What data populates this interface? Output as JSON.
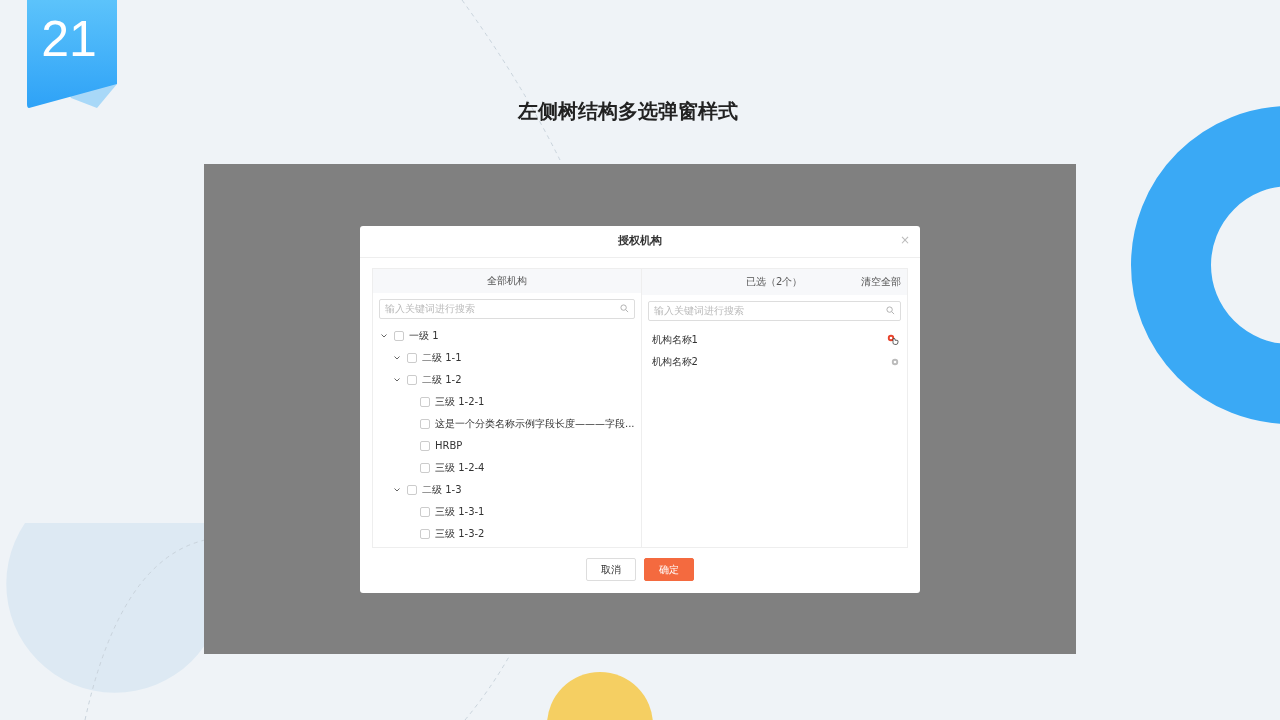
{
  "page_number": "21",
  "title": "左侧树结构多选弹窗样式",
  "dialog": {
    "title": "授权机构",
    "close": "×",
    "left_panel": {
      "header": "全部机构",
      "search": {
        "placeholder": "输入关键词进行搜索"
      },
      "tree": [
        {
          "label": "一级 1",
          "checked": false,
          "expanded": true,
          "children": [
            {
              "label": "二级 1-1",
              "checked": false,
              "expanded": true
            },
            {
              "label": "二级 1-2",
              "checked": false,
              "expanded": true,
              "children": [
                {
                  "label": "三级 1-2-1",
                  "checked": false
                },
                {
                  "label": "这是一个分类名称示例字段长度———字段...",
                  "checked": false
                },
                {
                  "label": "HRBP",
                  "checked": false
                },
                {
                  "label": "三级 1-2-4",
                  "checked": false
                }
              ]
            },
            {
              "label": "二级 1-3",
              "checked": false,
              "expanded": true,
              "children": [
                {
                  "label": "三级 1-3-1",
                  "checked": false
                },
                {
                  "label": "三级 1-3-2",
                  "checked": false
                }
              ]
            }
          ]
        }
      ]
    },
    "right_panel": {
      "header": "已选（2个）",
      "clear_all": "清空全部",
      "search": {
        "placeholder": "输入关键词进行搜索"
      },
      "items": [
        {
          "label": "机构名称1",
          "hovered": true
        },
        {
          "label": "机构名称2",
          "hovered": false
        }
      ]
    },
    "buttons": [
      {
        "label": "取消",
        "kind": "secondary"
      },
      {
        "label": "确定",
        "kind": "primary"
      }
    ]
  }
}
